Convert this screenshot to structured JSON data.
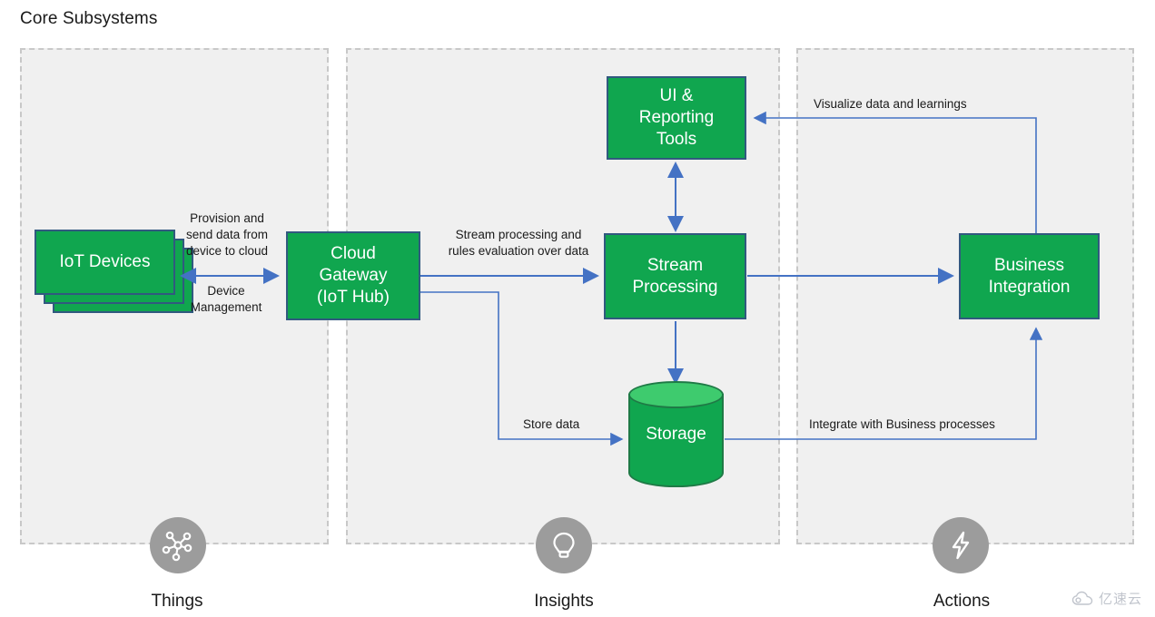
{
  "title": "Core Subsystems",
  "zones": [
    {
      "id": "things",
      "label": "Things",
      "icon": "network-nodes-icon"
    },
    {
      "id": "insights",
      "label": "Insights",
      "icon": "lightbulb-icon"
    },
    {
      "id": "actions",
      "label": "Actions",
      "icon": "lightning-bolt-icon"
    }
  ],
  "nodes": {
    "iot_devices": "IoT Devices",
    "cloud_gateway": "Cloud\nGateway\n(IoT Hub)",
    "cloud_gateway_line1": "Cloud",
    "cloud_gateway_line2": "Gateway",
    "cloud_gateway_line3": "(IoT Hub)",
    "ui_reporting": "UI &\nReporting\nTools",
    "ui_reporting_line1": "UI &",
    "ui_reporting_line2": "Reporting",
    "ui_reporting_line3": "Tools",
    "stream_processing": "Stream\nProcessing",
    "stream_processing_line1": "Stream",
    "stream_processing_line2": "Processing",
    "storage": "Storage",
    "business_integration": "Business\nIntegration",
    "business_integration_line1": "Business",
    "business_integration_line2": "Integration"
  },
  "edges": {
    "provision_line1": "Provision and",
    "provision_line2": "send data from",
    "provision_line3": "device to cloud",
    "device_mgmt_line1": "Device",
    "device_mgmt_line2": "Management",
    "stream_rules_line1": "Stream processing and",
    "stream_rules_line2": "rules evaluation over data",
    "store_data": "Store data",
    "visualize": "Visualize data and learnings",
    "integrate": "Integrate with Business processes"
  },
  "colors": {
    "node_fill": "#10A64F",
    "node_border": "#31597F",
    "storage_top": "#3ECB6E",
    "arrow": "#4472C4",
    "panel_fill": "#F0F0F0",
    "panel_border": "#C8C8C8",
    "zone_icon_bg": "#9C9C9C"
  },
  "watermark": {
    "text": "亿速云",
    "icon": "cloud-icon"
  }
}
